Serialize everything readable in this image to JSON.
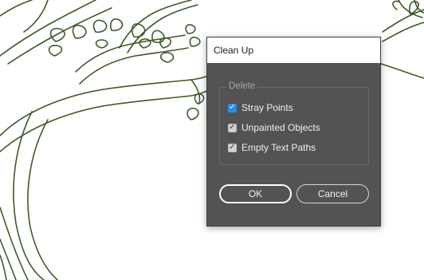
{
  "dialog": {
    "title": "Clean Up",
    "group_label": "Delete",
    "options": [
      {
        "label": "Stray Points",
        "checked": true,
        "style": "accent"
      },
      {
        "label": "Unpainted Objects",
        "checked": true,
        "style": "default"
      },
      {
        "label": "Empty Text Paths",
        "checked": true,
        "style": "default"
      }
    ],
    "ok_label": "OK",
    "cancel_label": "Cancel"
  },
  "colors": {
    "artwork_stroke": "#3d5a2a",
    "dialog_body": "#535353",
    "accent": "#2d8ceb"
  },
  "icons": {
    "checkmark": "check-icon"
  }
}
